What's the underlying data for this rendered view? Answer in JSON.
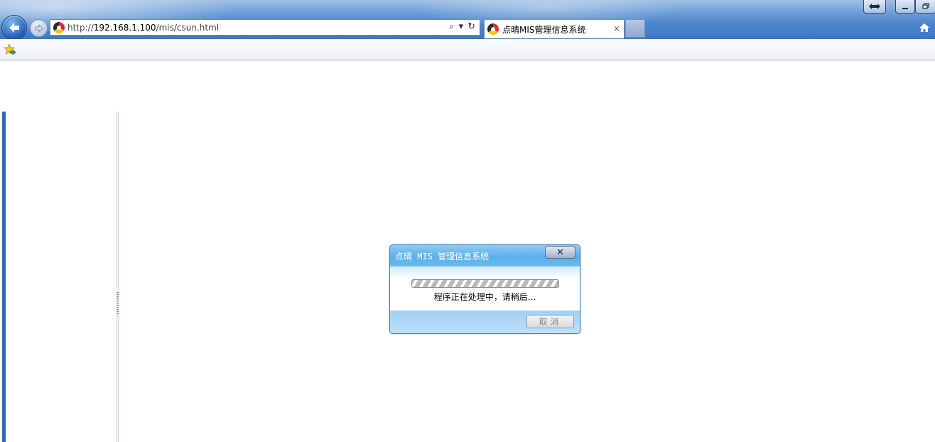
{
  "browser": {
    "address_url_prefix": "http://",
    "address_url_host": "192.168.1.100",
    "address_url_path": "/mis/csun.html",
    "tab_title": "点晴MIS管理信息系统",
    "tab_close": "×",
    "search_icon_glyph": "⌕",
    "dropdown_glyph": "▾",
    "refresh_glyph": "↻"
  },
  "dialog": {
    "title": "点晴 MIS 管理信息系统",
    "close_glyph": "✕",
    "message": "程序正在处理中，请稍后...",
    "cancel_label": "取消"
  },
  "colors": {
    "accent": "#3f78c2",
    "dialog_title": "#5ab0ea",
    "left_bar": "#2f68b6"
  }
}
